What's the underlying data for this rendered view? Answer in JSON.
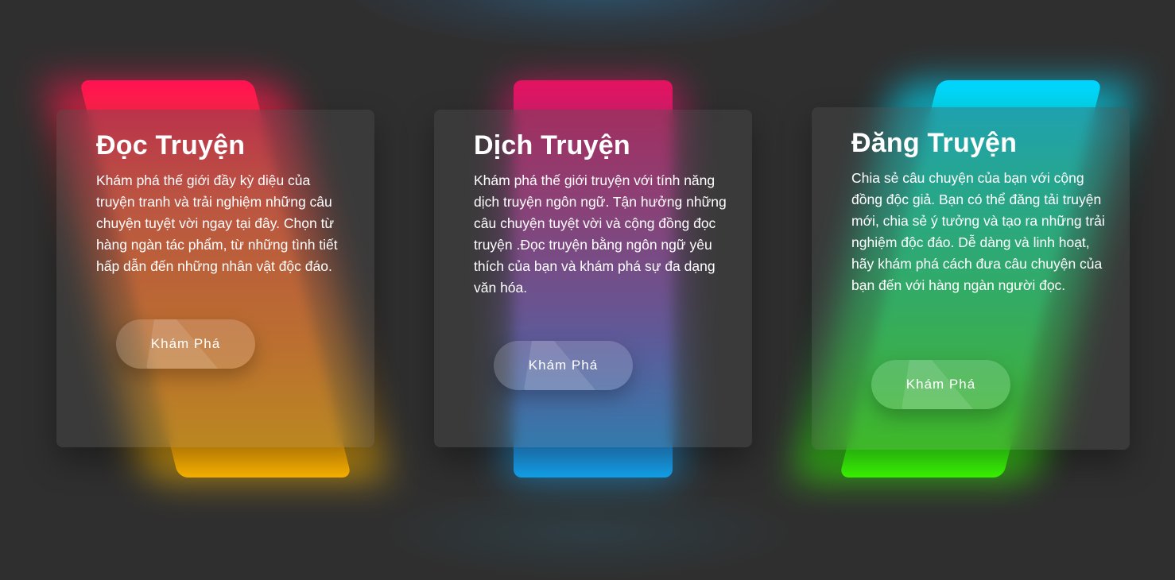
{
  "cards": [
    {
      "title": "Đọc Truyện",
      "description": "Khám phá thế giới đầy kỳ diệu của truyện tranh và trải nghiệm những câu chuyện tuyệt vời ngay tại đây. Chọn từ hàng ngàn tác phẩm, từ những tình tiết hấp dẫn đến những nhân vật độc đáo.",
      "button_label": "Khám Phá",
      "gradient_start": "#ff1150",
      "gradient_end": "#ffc000"
    },
    {
      "title": "Dịch Truyện",
      "description": "Khám phá thế giới truyện với tính năng dịch truyện ngôn ngữ. Tận hưởng những câu chuyện tuyệt vời và cộng đồng đọc truyện .Đọc truyện bằng ngôn ngữ yêu thích của bạn và khám phá sự đa dạng văn hóa.",
      "button_label": "Khám Phá",
      "gradient_start": "#e3125f",
      "gradient_end": "#11a6f0"
    },
    {
      "title": "Đăng Truyện",
      "description": "Chia sẻ câu chuyện của bạn với cộng đồng độc giả. Bạn có thể đăng tải truyện mới, chia sẻ ý tưởng và tạo ra những trải nghiệm độc đáo. Dễ dàng và linh hoạt, hãy khám phá cách đưa câu chuyện của bạn đến với hàng ngàn người đọc.",
      "button_label": "Khám Phá",
      "gradient_start": "#00d4ff",
      "gradient_end": "#3cff00"
    }
  ]
}
